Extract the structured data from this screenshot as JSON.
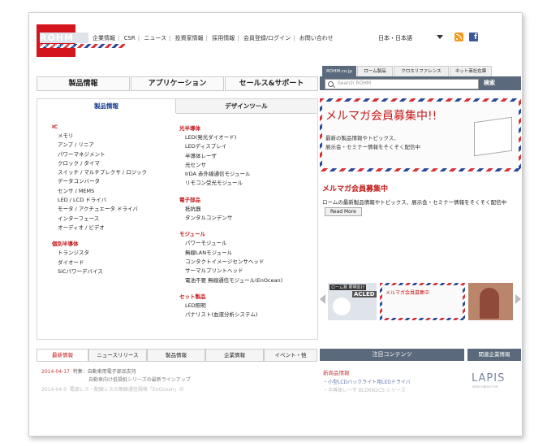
{
  "header": {
    "logo_text": "ROHM",
    "logo_sub": "SEMICONDUCTOR",
    "nav": [
      "企業情報",
      "CSR",
      "ニュース",
      "投資家情報",
      "採用情報",
      "会員登録/ログイン",
      "お問い合わせ"
    ],
    "language": "日本・日本語"
  },
  "main_nav": [
    "製品情報",
    "アプリケーション",
    "セールス&サポート"
  ],
  "site_tabs": [
    "ROHM.co.jp",
    "ローム製品",
    "クロスリファレンス",
    "ネット商社在庫"
  ],
  "search": {
    "placeholder": "Search ROHM",
    "button": "検索"
  },
  "category": {
    "tabs": [
      "製品情報",
      "デザインツール"
    ],
    "left": {
      "ic_heading": "IC",
      "ic_items": [
        "メモリ",
        "アンプ / リニア",
        "パワーマネジメント",
        "クロック / タイマ",
        "スイッチ / マルチプレクサ / ロジック",
        "データコンバータ",
        "センサ / MEMS",
        "LED / LCD ドライバ",
        "モータ / アクチュエータ ドライバ",
        "インターフェース",
        "オーディオ / ビデオ"
      ],
      "discrete_heading": "個別半導体",
      "discrete_items": [
        "トランジスタ",
        "ダイオード",
        "SiCパワーデバイス"
      ]
    },
    "right": {
      "opto_heading": "光半導体",
      "opto_items": [
        "LED(発光ダイオード)",
        "LEDディスプレイ",
        "半導体レーザ",
        "光センサ",
        "IrDA 赤外線通信モジュール",
        "リモコン受光モジュール"
      ],
      "passive_heading": "電子部品",
      "passive_items": [
        "抵抗器",
        "タンタルコンデンサ"
      ],
      "module_heading": "モジュール",
      "module_items": [
        "パワーモジュール",
        "無線LANモジュール",
        "コンタクトイメージセンサヘッド",
        "サーマルプリントヘッド",
        "電池不要 無線通信モジュール(EnOcean)"
      ],
      "set_heading": "セット製品",
      "set_items": [
        "LED照明",
        "パナリスト(血液分析システム)"
      ]
    }
  },
  "banner": {
    "title": "メルマガ会員募集中!!",
    "sub_line1": "最新の製品情報やトピックス、",
    "sub_line2": "展示会・セミナー情報をそくそく配信中"
  },
  "promo": {
    "title": "メルマガ会員募集中",
    "text": "ロームの最新製品情報やトピックス、展示会・セミナー情報をそくそく配信中",
    "read_more": "Read More"
  },
  "carousel": {
    "thumb1_label": "ローム発 照明向け",
    "thumb1_brand": "ACLED",
    "thumb2_title": "メルマガ会員募集中"
  },
  "news": {
    "tabs": [
      "最新情報",
      "ニュースリリース",
      "製品情報",
      "企業情報",
      "イベント・他"
    ],
    "date1": "2014-04-17",
    "text1a": "特集：自動車用電子部品支持",
    "text1b": "自動車向け低損抵シリーズの最新ラインアップ",
    "date2": "2014-04-0",
    "text2": "電源レス・配線レスの無線通信規格「EnOcean」の"
  },
  "featured": {
    "header": "注目コンテンツ",
    "new_products": "新商品情報",
    "line1": "・小型LCDバックライト用LEDドライバ",
    "line2": "・半導体レーザ BLD6N2CS シリーズ"
  },
  "related": {
    "header": "関連企業情報",
    "logo": "LAPIS",
    "logo_sub": "SEMICONDUCTOR"
  }
}
